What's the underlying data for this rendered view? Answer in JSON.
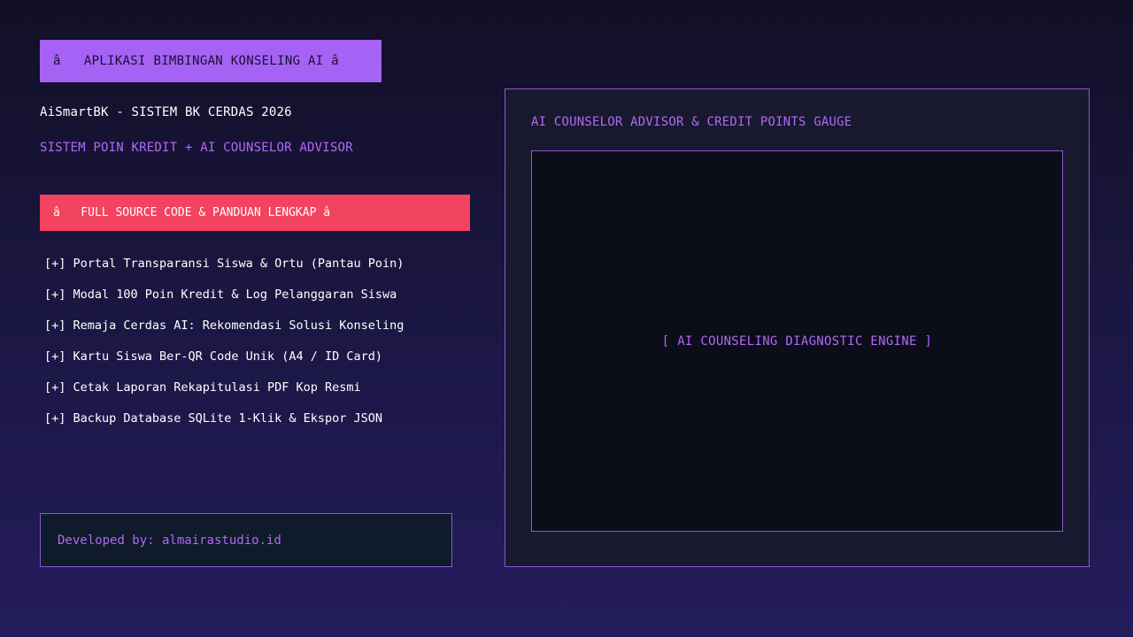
{
  "header": {
    "title_banner": "â   APLIKASI BIMBINGAN KONSELING AI â",
    "subtitle": "AiSmartBK - SISTEM BK CERDAS 2026",
    "tagline": "SISTEM POIN KREDIT + AI COUNSELOR ADVISOR"
  },
  "cta": {
    "label": "â   FULL SOURCE CODE & PANDUAN LENGKAP â"
  },
  "features": [
    "[+] Portal Transparansi Siswa & Ortu (Pantau Poin)",
    "[+] Modal 100 Poin Kredit & Log Pelanggaran Siswa",
    "[+] Remaja Cerdas AI: Rekomendasi Solusi Konseling",
    "[+] Kartu Siswa Ber-QR Code Unik (A4 / ID Card)",
    "[+] Cetak Laporan Rekapitulasi PDF Kop Resmi",
    "[+] Backup Database SQLite 1-Klik & Ekspor JSON"
  ],
  "footer": {
    "developer": "Developed by: almairastudio.id"
  },
  "panel": {
    "title": "AI COUNSELOR ADVISOR & CREDIT POINTS GAUGE",
    "engine_label": "[ AI COUNSELING DIAGNOSTIC ENGINE ]"
  },
  "colors": {
    "accent_purple": "#a662f5",
    "accent_red": "#f2435f",
    "text_purple": "#b168f7",
    "border_purple": "#8d57d6"
  }
}
